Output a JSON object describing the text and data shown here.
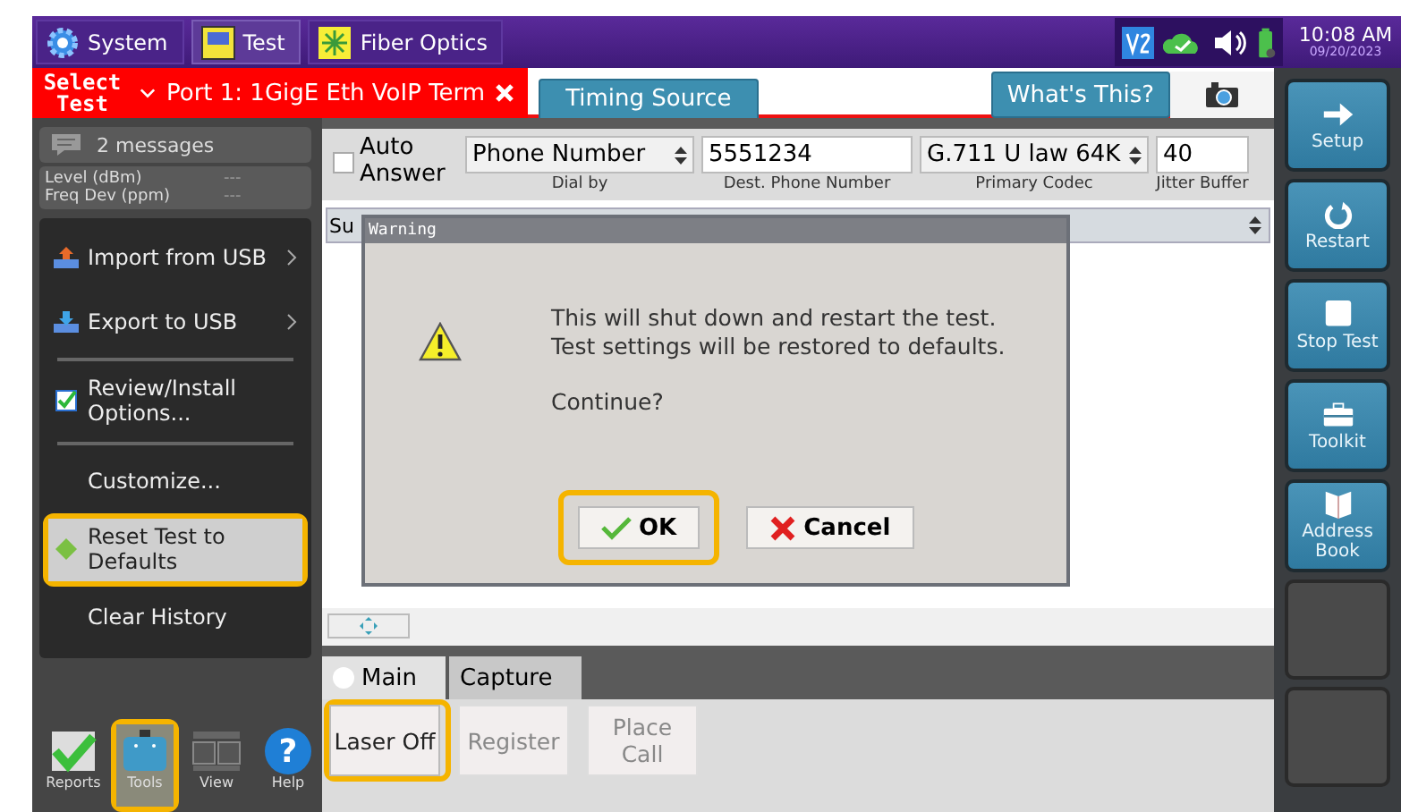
{
  "top_bar": {
    "tabs": [
      {
        "label": "System",
        "kind": "gear",
        "selected": false
      },
      {
        "label": "Test",
        "kind": "bert",
        "selected": true
      },
      {
        "label": "Fiber Optics",
        "kind": "fiber",
        "selected": false
      }
    ],
    "time": "10:08 AM",
    "date": "09/20/2023"
  },
  "test_bar": {
    "select_label": "Select Test",
    "test_tab": "Port 1: 1GigE Eth VoIP Term",
    "tabs": [
      {
        "label": "Timing Source",
        "selected": false
      }
    ],
    "help_button": "What's This?"
  },
  "sidebar": {
    "messages": "2 messages",
    "readings": [
      {
        "label": "Level (dBm)",
        "value": "---"
      },
      {
        "label": "Freq Dev (ppm)",
        "value": "---"
      }
    ],
    "menu_groups": [
      [
        {
          "label": "Import from USB",
          "kind": "import",
          "submenu": true,
          "selected": false,
          "highlighted": false
        },
        {
          "label": "Export to USB",
          "kind": "export",
          "submenu": true,
          "selected": false,
          "highlighted": false
        }
      ],
      [
        {
          "label": "Review/Install Options...",
          "kind": "check",
          "submenu": false,
          "selected": false,
          "highlighted": false
        }
      ],
      [
        {
          "label": "Customize...",
          "kind": "none",
          "submenu": false,
          "selected": false,
          "highlighted": false
        },
        {
          "label": "Reset Test to Defaults",
          "kind": "reset",
          "submenu": false,
          "selected": true,
          "highlighted": true
        },
        {
          "label": "Clear History",
          "kind": "none",
          "submenu": false,
          "selected": false,
          "highlighted": false
        }
      ]
    ],
    "nav": [
      {
        "label": "Reports",
        "kind": "reports",
        "selected": false,
        "highlighted": false
      },
      {
        "label": "Tools",
        "kind": "tools",
        "selected": true,
        "highlighted": true
      },
      {
        "label": "View",
        "kind": "view",
        "selected": false,
        "highlighted": false
      },
      {
        "label": "Help",
        "kind": "help",
        "icon_text": "?",
        "selected": false,
        "highlighted": false
      }
    ]
  },
  "params": {
    "auto_answer": {
      "label": "Auto Answer",
      "checked": false
    },
    "fields": [
      {
        "kind": "select",
        "value": "Phone Number",
        "label": "Dial by"
      },
      {
        "kind": "text",
        "value": "5551234",
        "label": "Dest. Phone Number"
      },
      {
        "kind": "select",
        "value": "G.711 U law 64K",
        "label": "Primary Codec"
      },
      {
        "kind": "text",
        "value": "40",
        "label": "Jitter Buffer"
      }
    ]
  },
  "results_select": {
    "value": "Su"
  },
  "dialog": {
    "title": "Warning",
    "lines": [
      "This will shut down and restart the test.",
      "Test settings will be restored to defaults."
    ],
    "question": "Continue?",
    "buttons": [
      {
        "label": "OK",
        "kind": "ok",
        "highlighted": true
      },
      {
        "label": "Cancel",
        "kind": "cancel",
        "highlighted": false
      }
    ]
  },
  "bottom_tabs": [
    {
      "label": "Main",
      "selected": true
    },
    {
      "label": "Capture",
      "selected": false
    }
  ],
  "actions": [
    {
      "label": "Laser Off",
      "disabled": false,
      "highlighted": true
    },
    {
      "label": "Register",
      "disabled": true,
      "highlighted": false
    },
    {
      "label": "Place Call",
      "disabled": true,
      "highlighted": false
    }
  ],
  "right_buttons": [
    {
      "label": "Setup",
      "kind": "arrow"
    },
    {
      "label": "Restart",
      "kind": "restart"
    },
    {
      "label": "Stop Test",
      "kind": "stop"
    },
    {
      "label": "Toolkit",
      "kind": "toolkit"
    },
    {
      "label": "Address Book",
      "kind": "book"
    },
    {
      "kind": "blank"
    },
    {
      "kind": "blank"
    }
  ]
}
